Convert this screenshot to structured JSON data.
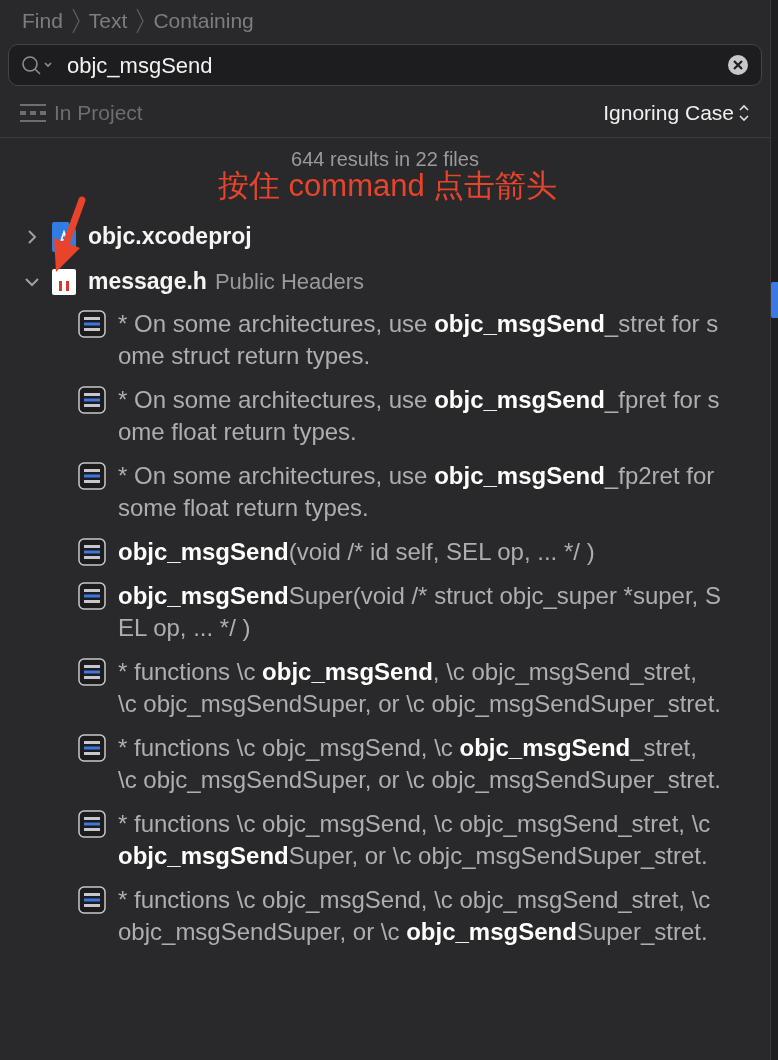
{
  "breadcrumb": [
    "Find",
    "Text",
    "Containing"
  ],
  "search": {
    "value": "objc_msgSend"
  },
  "scope": "In Project",
  "matching": "Ignoring Case",
  "summary": "644 results in 22 files",
  "annotation": {
    "text": "按住 command 点击箭头"
  },
  "files": [
    {
      "name": "objc.xcodeproj",
      "kind": "project",
      "expanded": false
    },
    {
      "name": "message.h",
      "group": "Public Headers",
      "kind": "header",
      "expanded": true,
      "results": [
        {
          "text": "* On some architectures, use **objc_msgSend**_stret for some struct return types."
        },
        {
          "text": "* On some architectures, use **objc_msgSend**_fpret for some float return types."
        },
        {
          "text": "* On some architectures, use **objc_msgSend**_fp2ret for some float return types."
        },
        {
          "text": "**objc_msgSend**(void /* id self, SEL op, ... */ )"
        },
        {
          "text": "**objc_msgSend**Super(void /* struct objc_super *super, SEL op, ... */ )"
        },
        {
          "text": "*  functions \\c **objc_msgSend**, \\c objc_msgSend_stret, \\c objc_msgSendSuper, or \\c objc_msgSendSuper_stret."
        },
        {
          "text": "*  functions \\c objc_msgSend, \\c **objc_msgSend**_stret, \\c objc_msgSendSuper, or \\c objc_msgSendSuper_stret."
        },
        {
          "text": "*  functions \\c objc_msgSend, \\c objc_msgSend_stret, \\c **objc_msgSend**Super, or \\c objc_msgSendSuper_stret."
        },
        {
          "text": "*  functions \\c objc_msgSend, \\c objc_msgSend_stret, \\c objc_msgSendSuper, or \\c **objc_msgSend**Super_stret."
        }
      ]
    }
  ]
}
